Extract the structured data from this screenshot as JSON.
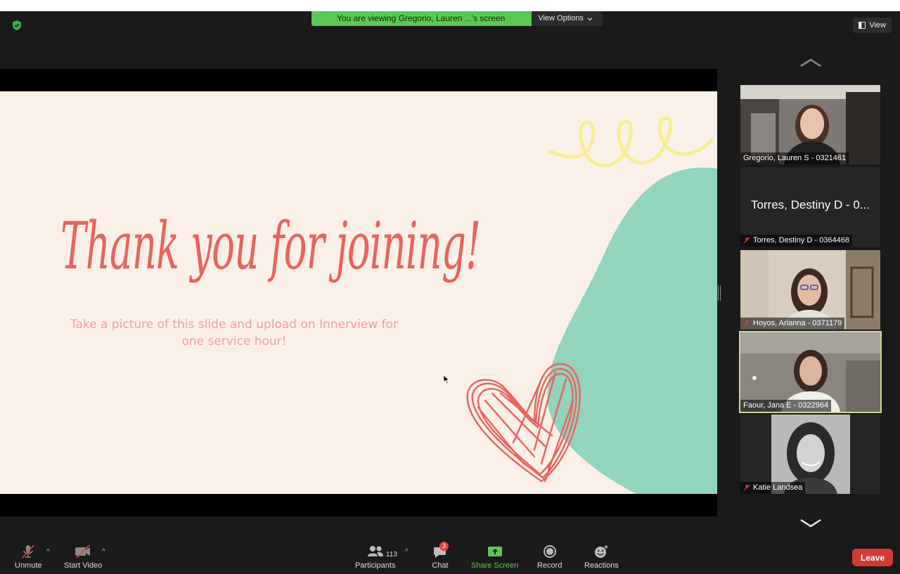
{
  "banner": {
    "text": "You are viewing Gregorio, Lauren ...'s screen",
    "view_options": "View Options"
  },
  "view_button": "View",
  "slide": {
    "title": "Thank you for joining!",
    "subtitle": "Take a picture of this slide and upload on Innerview for one service hour!"
  },
  "participants": [
    {
      "name": "Gregorio, Lauren S - 0321461",
      "muted": false,
      "video": true
    },
    {
      "name": "Torres, Destiny D - 0364468",
      "display_name": "Torres, Destiny D - 0...",
      "muted": true,
      "video": false
    },
    {
      "name": "Hoyos, Arianna - 0371179",
      "muted": true,
      "video": true
    },
    {
      "name": "Faour, Jana E - 0322964",
      "muted": false,
      "video": true,
      "active_speaker": true
    },
    {
      "name": "Katie Landsea",
      "muted": true,
      "video": true
    }
  ],
  "toolbar": {
    "unmute": "Unmute",
    "start_video": "Start Video",
    "participants": "Participants",
    "participant_count": "113",
    "chat": "Chat",
    "chat_badge": "3",
    "share_screen": "Share Screen",
    "record": "Record",
    "reactions": "Reactions",
    "leave": "Leave"
  },
  "colors": {
    "banner_green": "#5cc854",
    "slide_bg": "#fbf0e7",
    "slide_title": "#e8645f",
    "slide_subtitle": "#eda0a0",
    "blob_teal": "#92d4bc",
    "squiggle_yellow": "#f7ec93",
    "leave_red": "#d03b37",
    "active_border": "#c6d98a",
    "share_green": "#5cc854"
  },
  "icons": [
    "shield-icon",
    "view-icon",
    "chevron-up-icon",
    "chevron-down-icon",
    "mic-muted-icon",
    "video-off-icon",
    "participants-icon",
    "chat-icon",
    "share-screen-icon",
    "record-icon",
    "reactions-icon"
  ]
}
